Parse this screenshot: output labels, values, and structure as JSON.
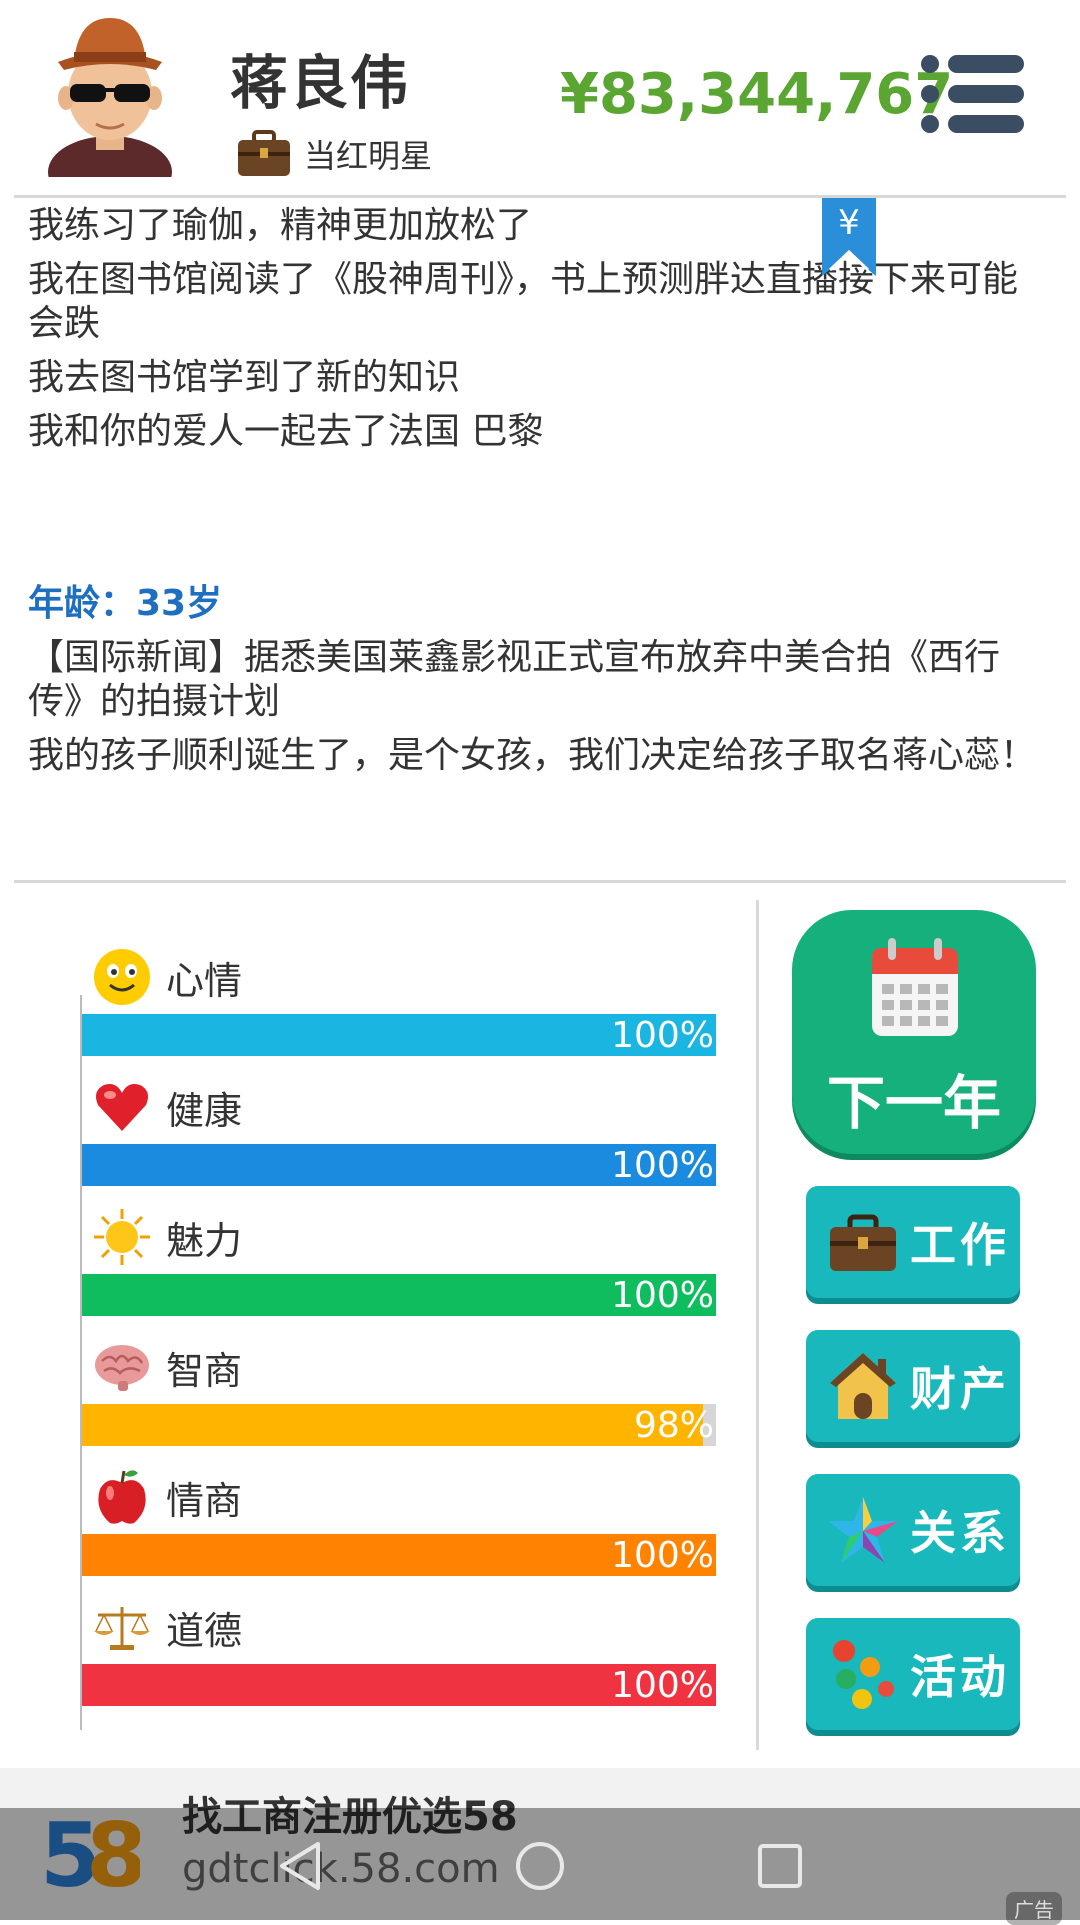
{
  "header": {
    "player_name": "蒋良伟",
    "job_title": "当红明星",
    "money": "¥83,344,767"
  },
  "log": {
    "lines_before": [
      "我练习了瑜伽，精神更加放松了",
      "我在图书馆阅读了《股神周刊》，书上预测胖达直播接下来可能会跌",
      "我去图书馆学到了新的知识",
      "我和你的爱人一起去了法国 巴黎"
    ],
    "age": "年龄：33岁",
    "lines_after": [
      "【国际新闻】据悉美国莱鑫影视正式宣布放弃中美合拍《西行传》的拍摄计划",
      "我的孩子顺利诞生了，是个女孩，我们决定给孩子取名蒋心蕊！"
    ],
    "bookmark_symbol": "¥"
  },
  "stats": [
    {
      "label": "心情",
      "value": 1.0,
      "pct": "100%",
      "color": "#1ab5e0",
      "icon": "smiley-icon"
    },
    {
      "label": "健康",
      "value": 1.0,
      "pct": "100%",
      "color": "#1b8be0",
      "icon": "heart-icon"
    },
    {
      "label": "魅力",
      "value": 1.0,
      "pct": "100%",
      "color": "#0fbd5e",
      "icon": "sun-icon"
    },
    {
      "label": "智商",
      "value": 0.98,
      "pct": "98%",
      "color": "#ffb400",
      "icon": "brain-icon"
    },
    {
      "label": "情商",
      "value": 1.0,
      "pct": "100%",
      "color": "#ff8200",
      "icon": "apple-icon"
    },
    {
      "label": "道德",
      "value": 1.0,
      "pct": "100%",
      "color": "#ef3340",
      "icon": "scales-icon"
    }
  ],
  "actions": {
    "next_year": "下一年",
    "work": "工作",
    "property": "财产",
    "relations": "关系",
    "activities": "活动"
  },
  "ad": {
    "title": "找工商注册优选58",
    "url": "gdtclick.58.com",
    "tag": "广告"
  }
}
